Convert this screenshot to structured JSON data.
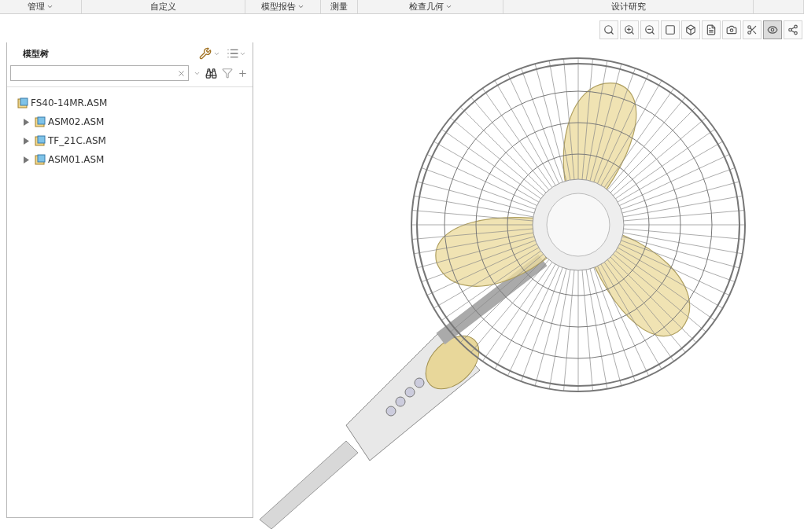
{
  "ribbon_groups": [
    {
      "label": "管理",
      "dropdown": true
    },
    {
      "label": "自定义",
      "dropdown": false
    },
    {
      "label": "模型报告",
      "dropdown": true
    },
    {
      "label": "测量",
      "dropdown": false
    },
    {
      "label": "检查几何",
      "dropdown": true
    },
    {
      "label": "设计研究",
      "dropdown": false
    }
  ],
  "view_toolbar": [
    {
      "selected": false
    },
    {
      "selected": false
    },
    {
      "selected": false
    },
    {
      "selected": false
    },
    {
      "selected": false
    },
    {
      "selected": false
    },
    {
      "selected": false
    },
    {
      "selected": false
    },
    {
      "selected": true
    },
    {
      "selected": false
    }
  ],
  "model_tree": {
    "title": "模型树",
    "items": [
      {
        "label": "FS40-14MR.ASM",
        "children": [
          {
            "label": "ASM02.ASM",
            "expanded": false
          },
          {
            "label": "TF_21C.ASM",
            "expanded": false
          },
          {
            "label": "ASM01.ASM",
            "expanded": false
          }
        ]
      }
    ]
  }
}
